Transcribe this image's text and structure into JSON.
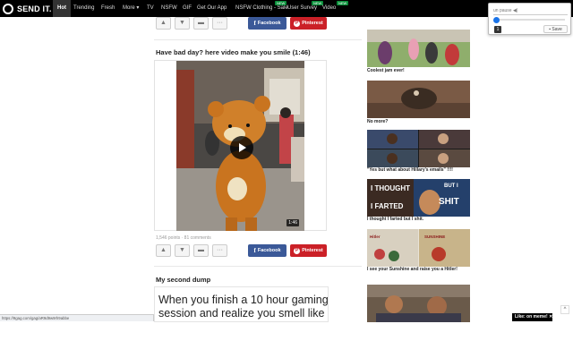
{
  "nav": {
    "logo": "SEND IT.",
    "items": [
      {
        "label": "Hot",
        "active": true
      },
      {
        "label": "Trending"
      },
      {
        "label": "Fresh"
      },
      {
        "label": "More ▾"
      },
      {
        "label": "TV"
      },
      {
        "label": "NSFW"
      },
      {
        "label": "GIF"
      },
      {
        "label": "Get Our App"
      },
      {
        "label": "NSFW Clothing - Sale",
        "badge": "NEW"
      },
      {
        "label": "User Survey",
        "badge": "NEW"
      },
      {
        "label": "Video",
        "badge": "NEW"
      }
    ]
  },
  "post_top": {
    "facebook_label": "Facebook",
    "pinterest_label": "Pinterest",
    "more_label": "···"
  },
  "post_video": {
    "title": "Have bad day? here video make you smile (1:46)",
    "duration": "1:46",
    "meta": "1,546 points · 81 comments",
    "facebook_label": "Facebook",
    "pinterest_label": "Pinterest",
    "more_label": "···"
  },
  "post_dump": {
    "title": "My second dump",
    "text": "When you finish a 10 hour gaming session and realize you smell like"
  },
  "sidebar": {
    "items": [
      {
        "caption": "Coolest jam ever!"
      },
      {
        "caption": "No more?"
      },
      {
        "caption": "\"Yes but what about Hillary's emails\" !!!!"
      },
      {
        "caption": "I thought I farted but I shit.",
        "overlay_top": "I THOUGHT",
        "overlay_mid": "BUT I",
        "overlay_bottom": "I FARTED",
        "overlay_right": "SHIT"
      },
      {
        "caption": "I see your Sunshine and raise you a Hitler!",
        "overlay_left": "Hitler",
        "overlay_right": "SUNSHINE"
      },
      {
        "caption": ""
      }
    ]
  },
  "popup": {
    "input_text": "un pause ◀)",
    "number": "1",
    "save_label": "Save"
  },
  "like_bar": "Like: on meme! ✕",
  "scroll_top": "^",
  "status_url": "https://9gag.com/gag/aR9d9w9rh9abbe"
}
